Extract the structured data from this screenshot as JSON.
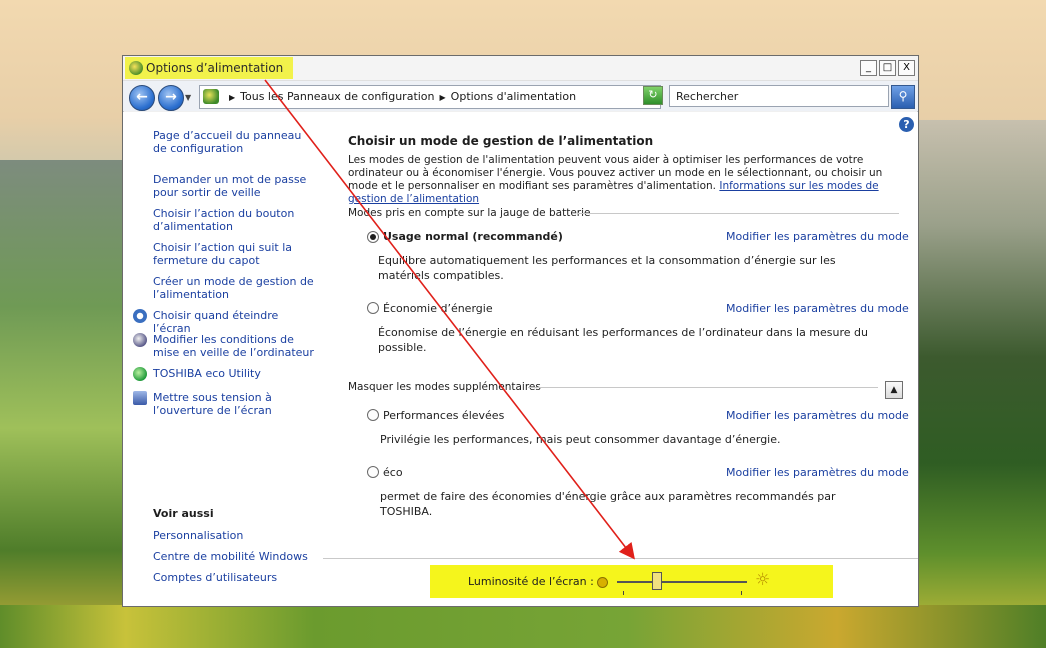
{
  "window": {
    "title": "Options d’alimentation",
    "buttons": [
      "_",
      "□",
      "X"
    ]
  },
  "addressbar": {
    "back_icon": "back-arrow-icon",
    "forward_icon": "forward-arrow-icon",
    "breadcrumbs": [
      "Tous les Panneaux de configuration",
      "Options d'alimentation"
    ],
    "search_value": "Rechercher"
  },
  "sidebar": {
    "links": [
      "Page d’accueil du panneau de configuration",
      "Demander un mot de passe pour sortir de veille",
      "Choisir l’action du bouton d’alimentation",
      "Choisir l’action qui suit la fermeture du capot",
      "Créer un mode de gestion de l’alimentation",
      "Choisir quand éteindre l’écran",
      "Modifier les conditions de mise en veille de l’ordinateur",
      "TOSHIBA eco Utility",
      "Mettre sous tension à l’ouverture de l’écran"
    ],
    "see_also_title": "Voir aussi",
    "see_also": [
      "Personnalisation",
      "Centre de mobilité Windows",
      "Comptes d’utilisateurs"
    ]
  },
  "main": {
    "heading": "Choisir un mode de gestion de l’alimentation",
    "intro": "Les modes de gestion de l'alimentation peuvent vous aider à optimiser les performances de votre ordinateur ou à économiser l'énergie. Vous pouvez activer un mode en le sélectionnant, ou choisir un mode et le personnaliser en modifiant ses paramètres d'alimentation.",
    "intro_link": "Informations sur les modes de gestion de l’alimentation",
    "section1": "Modes pris en compte sur la jauge de batterie",
    "section2": "Masquer les modes supplémentaires",
    "change_link": "Modifier les paramètres du mode",
    "plans": [
      {
        "name": "Usage normal (recommandé)",
        "desc": "Equilibre automatiquement les performances et la consommation d’énergie sur les matériels compatibles.",
        "selected": true
      },
      {
        "name": "Économie d’énergie",
        "desc": "Économise de l’énergie en réduisant les performances de l’ordinateur dans la mesure du possible.",
        "selected": false
      },
      {
        "name": "Performances élevées",
        "desc": "Privilégie les performances, mais peut consommer davantage d’énergie.",
        "selected": false
      },
      {
        "name": "éco",
        "desc": "permet de faire des économies d'énergie grâce aux paramètres recommandés par TOSHIBA.",
        "selected": false
      }
    ]
  },
  "brightness": {
    "label": "Luminosité de l’écran :",
    "level_percent": 30
  },
  "colors": {
    "highlight": "#f5f51c",
    "link": "#1a3fa0",
    "annotation_arrow": "#e0201a"
  }
}
